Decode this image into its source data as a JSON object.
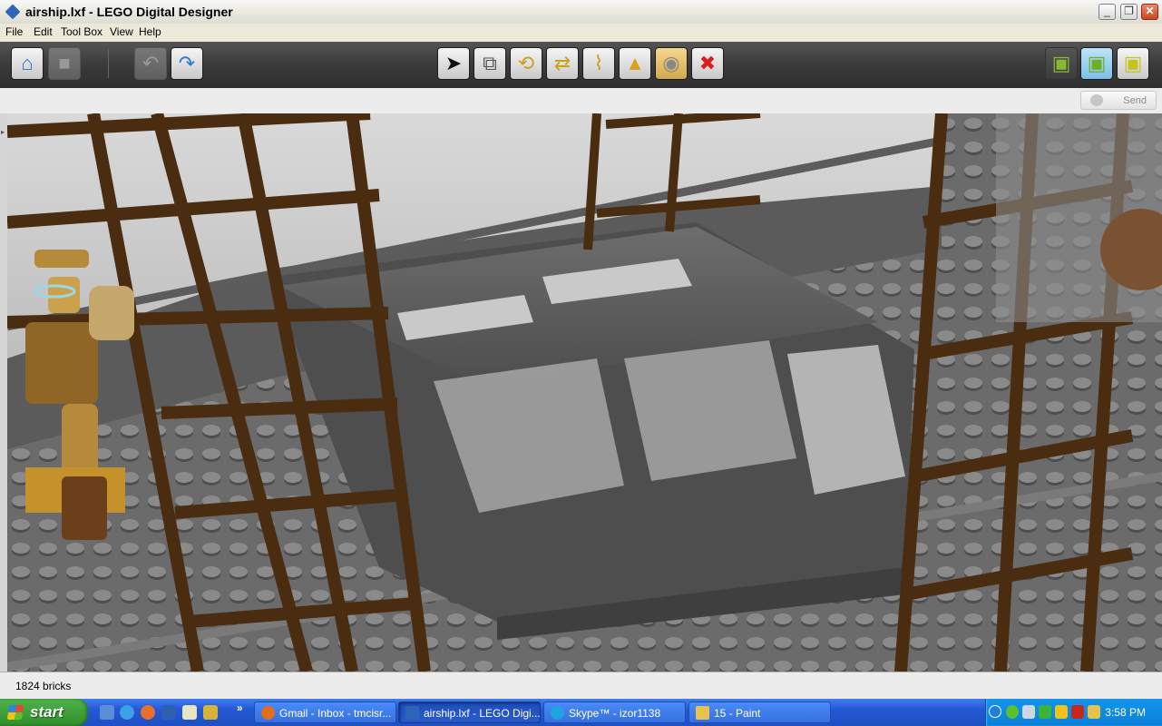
{
  "window": {
    "title": "airship.lxf - LEGO Digital Designer"
  },
  "menu": [
    "File",
    "Edit",
    "Tool Box",
    "View",
    "Help"
  ],
  "toolbar": {
    "left": [
      {
        "name": "home-button",
        "icon": "house-icon",
        "glyph": "⌂"
      },
      {
        "name": "save-button",
        "icon": "disk-icon",
        "glyph": "■",
        "disabled": true
      },
      {
        "name": "undo-button",
        "icon": "undo-arrow-icon",
        "glyph": "↶",
        "disabled": true
      },
      {
        "name": "redo-button",
        "icon": "redo-arrow-icon",
        "glyph": "↷"
      }
    ],
    "tools": [
      {
        "name": "select-tool-button",
        "icon": "cursor-icon",
        "glyph": "➤"
      },
      {
        "name": "clone-tool-button",
        "icon": "clone-brick-icon",
        "glyph": "⧉"
      },
      {
        "name": "hinge-tool-button",
        "icon": "hinge-icon",
        "glyph": "⟲"
      },
      {
        "name": "hinge-align-tool-button",
        "icon": "hinge-align-icon",
        "glyph": "⇄"
      },
      {
        "name": "flex-tool-button",
        "icon": "flex-icon",
        "glyph": "⌇"
      },
      {
        "name": "paint-tool-button",
        "icon": "paint-bucket-icon",
        "glyph": "▲"
      },
      {
        "name": "hide-tool-button",
        "icon": "hide-icon",
        "glyph": "◉",
        "active": true
      },
      {
        "name": "delete-tool-button",
        "icon": "delete-x-icon",
        "glyph": "✖"
      }
    ],
    "modes": [
      {
        "name": "build-mode-button",
        "icon": "build-mode-icon",
        "glyph": "▣"
      },
      {
        "name": "view-mode-button",
        "icon": "view-mode-icon",
        "glyph": "▣"
      },
      {
        "name": "building-guide-mode-button",
        "icon": "building-guide-icon",
        "glyph": "▣"
      }
    ]
  },
  "subbar": {
    "send_label": "Send"
  },
  "status": {
    "text": "1824 bricks"
  },
  "taskbar": {
    "start_label": "start",
    "quick_launch": [
      "desktop-icon",
      "ie-icon",
      "firefox-icon",
      "word-icon",
      "outlook-icon",
      "utility-icon"
    ],
    "chevron": "»",
    "tasks": [
      {
        "label": "Gmail - Inbox - tmcisr...",
        "color": "#e36c1d",
        "active": false
      },
      {
        "label": "airship.lxf - LEGO Digi...",
        "color": "#2d66b9",
        "active": true
      },
      {
        "label": "Skype™ - izor1138",
        "color": "#1fa3e0",
        "active": false
      },
      {
        "label": "15 - Paint",
        "color": "#e7c34b",
        "active": false
      }
    ],
    "clock": "3:58 PM"
  },
  "colors": {
    "wood": "#4a2c10",
    "plate": "#6e6e6e",
    "stud": "#7f7f7f",
    "figure": "#b58a3a",
    "glass": "#cfcfcf",
    "toolbar_bg": "#3a3a3a",
    "taskbar": "#2458d3",
    "delete_red": "#d81e1e"
  }
}
